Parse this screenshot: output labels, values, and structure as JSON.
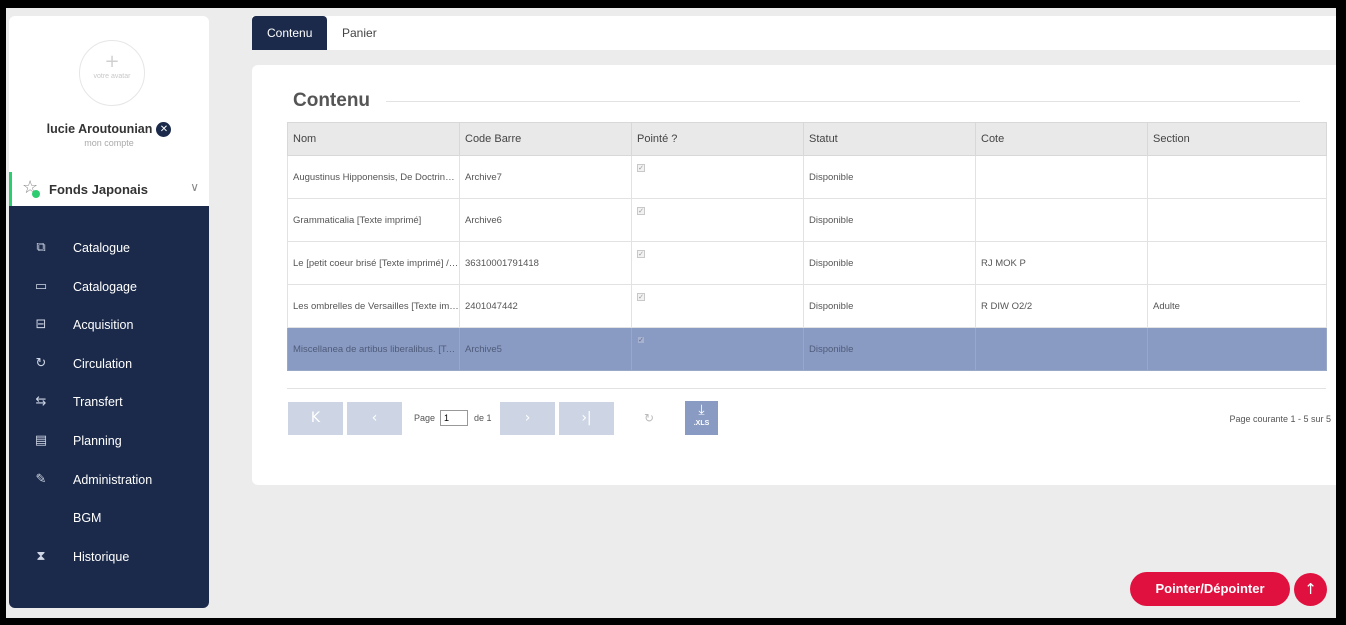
{
  "sidebar": {
    "avatar_plus": "+",
    "avatar_text": "votre avatar",
    "user_name": "lucie Aroutounian",
    "account_label": "mon compte",
    "fonds_label": "Fonds Japonais",
    "items": [
      {
        "icon": "catalogue-icon",
        "glyph": "⧉",
        "label": "Catalogue"
      },
      {
        "icon": "book-icon",
        "glyph": "▭",
        "label": "Catalogage"
      },
      {
        "icon": "acquisition-icon",
        "glyph": "⊟",
        "label": "Acquisition"
      },
      {
        "icon": "circulation-icon",
        "glyph": "↻",
        "label": "Circulation"
      },
      {
        "icon": "transfer-icon",
        "glyph": "⇆",
        "label": "Transfert"
      },
      {
        "icon": "calendar-icon",
        "glyph": "▤",
        "label": "Planning"
      },
      {
        "icon": "administration-icon",
        "glyph": "✎",
        "label": "Administration"
      },
      {
        "icon": "",
        "glyph": "",
        "label": "BGM"
      },
      {
        "icon": "hourglass-icon",
        "glyph": "⧗",
        "label": "Historique"
      }
    ]
  },
  "tabs": [
    {
      "label": "Contenu",
      "active": true
    },
    {
      "label": "Panier",
      "active": false
    }
  ],
  "main": {
    "title": "Contenu",
    "columns": [
      "Nom",
      "Code Barre",
      "Pointé ?",
      "Statut",
      "Cote",
      "Section"
    ],
    "rows": [
      {
        "nom": "Augustinus Hipponensis, De Doctrina c...",
        "code": "Archive7",
        "pointe": true,
        "statut": "Disponible",
        "cote": "",
        "section": "",
        "selected": false
      },
      {
        "nom": "Grammaticalia [Texte imprimé]",
        "code": "Archive6",
        "pointe": true,
        "statut": "Disponible",
        "cote": "",
        "section": "",
        "selected": false
      },
      {
        "nom": "Le [petit coeur brisé [Texte imprimé] / ...",
        "code": "36310001791418",
        "pointe": true,
        "statut": "Disponible",
        "cote": "RJ MOK P",
        "section": "",
        "selected": false
      },
      {
        "nom": "Les ombrelles de Versailles [Texte imp...",
        "code": "2401047442",
        "pointe": true,
        "statut": "Disponible",
        "cote": "R DIW O2/2",
        "section": "Adulte",
        "selected": false
      },
      {
        "nom": "Miscellanea de artibus liberalibus. [Tex...",
        "code": "Archive5",
        "pointe": true,
        "statut": "Disponible",
        "cote": "",
        "section": "",
        "selected": true
      }
    ],
    "pager": {
      "first_glyph": "K",
      "prev_glyph": "‹",
      "next_glyph": "›",
      "last_glyph": "›|",
      "page_label": "Page",
      "page_value": "1",
      "of_label": "de 1",
      "refresh_glyph": "↻",
      "xls_arrow": "⤓",
      "xls_label": ".XLS",
      "status": "Page courante 1 - 5 sur 5"
    }
  },
  "actions": {
    "pointer_label": "Pointer/Dépointer",
    "scroll_top_glyph": "↑"
  },
  "colors": {
    "navy": "#1b2a4a",
    "accent_red": "#e0113e",
    "selected_row": "#8a9bc3",
    "green": "#2ecc71"
  }
}
